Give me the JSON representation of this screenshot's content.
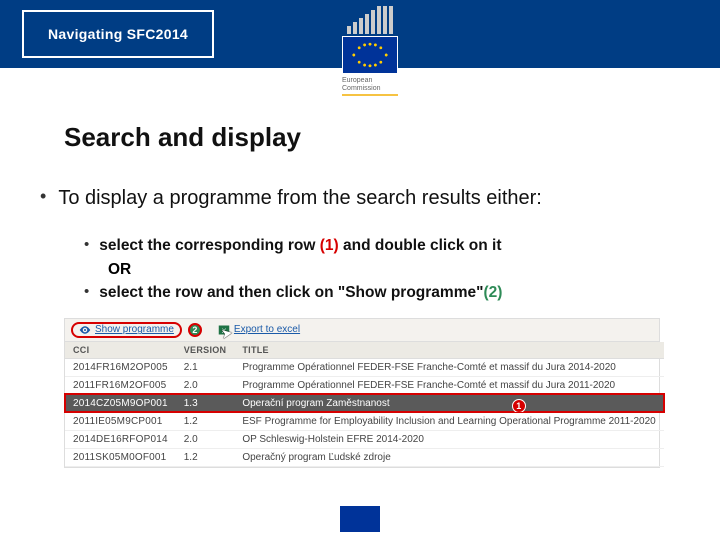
{
  "header": {
    "nav_chip": "Navigating SFC2014",
    "logo_caption": "European Commission"
  },
  "title": "Search and display",
  "intro": "To display a programme from the search results either:",
  "sub": {
    "item1_pre": "select the corresponding row ",
    "item1_marker": "(1)",
    "item1_post": " and double click on it",
    "or": "OR",
    "item2_pre": "select the row and then click on \"Show programme\"",
    "item2_marker": "(2)"
  },
  "shot": {
    "toolbar": {
      "show_label": "Show programme",
      "export_label": "Export to excel",
      "badge2": "2"
    },
    "columns": {
      "cci": "CCI",
      "version": "Version",
      "title": "Title"
    },
    "rows": [
      {
        "cci": "2014FR16M2OP005",
        "version": "2.1",
        "title": "Programme Opérationnel  FEDER-FSE  Franche-Comté et massif du Jura 2014-2020"
      },
      {
        "cci": "2011FR16M2OF005",
        "version": "2.0",
        "title": "Programme Opérationnel FEDER-FSE Franche-Comté et massif du Jura 2011-2020"
      },
      {
        "cci": "2014CZ05M9OP001",
        "version": "1.3",
        "title": "Operační program Zaměstnanost",
        "selected": true,
        "badge": "1"
      },
      {
        "cci": "2011IE05M9CP001",
        "version": "1.2",
        "title": "ESF Programme for Employability Inclusion and Learning Operational Programme 2011-2020"
      },
      {
        "cci": "2014DE16RFOP014",
        "version": "2.0",
        "title": "OP Schleswig-Holstein EFRE 2014-2020"
      },
      {
        "cci": "2011SK05M0OF001",
        "version": "1.2",
        "title": "Operačný program Ľudské zdroje"
      }
    ]
  }
}
